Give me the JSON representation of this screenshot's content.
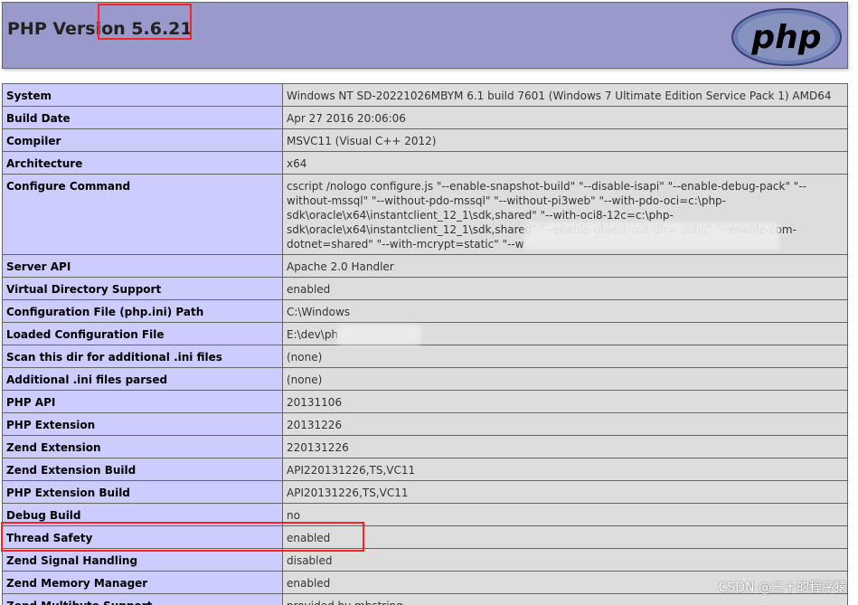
{
  "header": {
    "title": "PHP Version 5.6.21",
    "logo_text": "php"
  },
  "rows": [
    {
      "key": "System",
      "value": "Windows NT SD-20221026MBYM 6.1 build 7601 (Windows 7 Ultimate Edition Service Pack 1) AMD64"
    },
    {
      "key": "Build Date",
      "value": "Apr 27 2016 20:06:06"
    },
    {
      "key": "Compiler",
      "value": "MSVC11 (Visual C++ 2012)"
    },
    {
      "key": "Architecture",
      "value": "x64"
    },
    {
      "key": "Configure Command",
      "value": "cscript /nologo configure.js \"--enable-snapshot-build\" \"--disable-isapi\" \"--enable-debug-pack\" \"--without-mssql\" \"--without-pdo-mssql\" \"--without-pi3web\" \"--with-pdo-oci=c:\\php-sdk\\oracle\\x64\\instantclient_12_1\\sdk,shared\" \"--with-oci8-12c=c:\\php-sdk\\oracle\\x64\\instantclient_12_1\\sdk,shared\" \"--enable-object-out-dir=../obj/\" \"--enable-com-dotnet=shared\" \"--with-mcrypt=static\" \"--w"
    },
    {
      "key": "Server API",
      "value": "Apache 2.0 Handler"
    },
    {
      "key": "Virtual Directory Support",
      "value": "enabled"
    },
    {
      "key": "Configuration File (php.ini) Path",
      "value": "C:\\Windows"
    },
    {
      "key": "Loaded Configuration File",
      "value": "E:\\dev\\ph"
    },
    {
      "key": "Scan this dir for additional .ini files",
      "value": "(none)"
    },
    {
      "key": "Additional .ini files parsed",
      "value": "(none)"
    },
    {
      "key": "PHP API",
      "value": "20131106"
    },
    {
      "key": "PHP Extension",
      "value": "20131226"
    },
    {
      "key": "Zend Extension",
      "value": "220131226"
    },
    {
      "key": "Zend Extension Build",
      "value": "API220131226,TS,VC11"
    },
    {
      "key": "PHP Extension Build",
      "value": "API20131226,TS,VC11"
    },
    {
      "key": "Debug Build",
      "value": "no"
    },
    {
      "key": "Thread Safety",
      "value": "enabled"
    },
    {
      "key": "Zend Signal Handling",
      "value": "disabled"
    },
    {
      "key": "Zend Memory Manager",
      "value": "enabled"
    },
    {
      "key": "Zend Multibyte Support",
      "value": "provided by mbstring"
    }
  ],
  "watermark": "CSDN @三十的程序猿",
  "colors": {
    "header_bg": "#9999cc",
    "key_bg": "#ccccff",
    "value_bg": "#dddddd",
    "highlight": "#ff2222"
  }
}
